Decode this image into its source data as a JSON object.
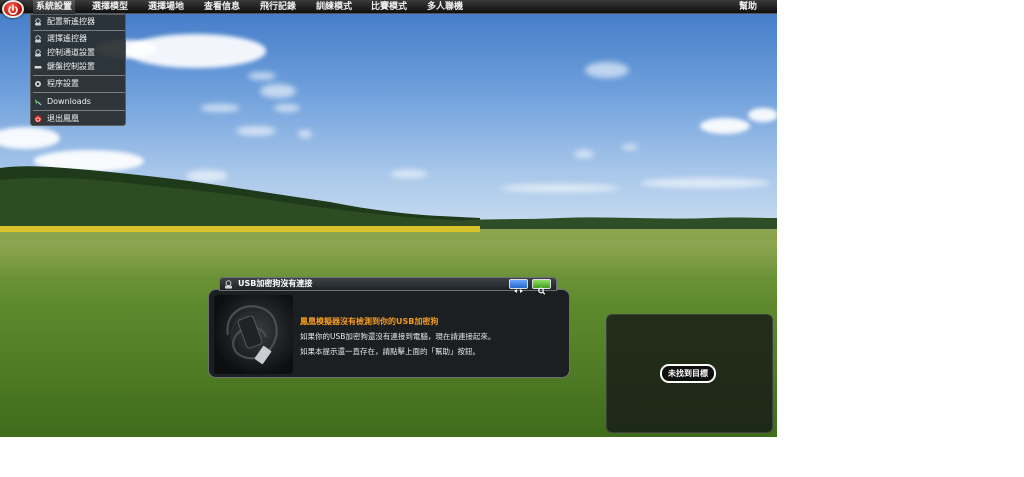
{
  "menu": {
    "items": [
      "系統設置",
      "選擇模型",
      "選擇場地",
      "查看信息",
      "飛行記錄",
      "訓練模式",
      "比賽模式",
      "多人聯機"
    ],
    "help": "幫助",
    "active_index": 0
  },
  "dropdown": {
    "items": [
      {
        "label": "配置新遙控器",
        "icon": "controller-icon"
      },
      {
        "label": "選擇遙控器",
        "icon": "controller-icon"
      },
      {
        "label": "控制通道設置",
        "icon": "controller-icon"
      },
      {
        "label": "鍵盤控制設置",
        "icon": "keyboard-icon"
      },
      {
        "label": "程序設置",
        "icon": "gear-icon"
      },
      {
        "label": "Downloads",
        "icon": "download-icon"
      },
      {
        "label": "退出鳳凰",
        "icon": "power-icon"
      }
    ]
  },
  "dialog": {
    "title": "USB加密狗沒有連接",
    "message_title": "鳳凰模擬器沒有檢測到你的USB加密狗",
    "message_lines": [
      "如果你的USB加密狗還沒有連接到電腦，現在請連接起來。",
      "如果本提示還一直存在，請點擊上面的「幫助」按鈕。"
    ]
  },
  "target_panel": {
    "label": "未找到目標"
  },
  "colors": {
    "accent_orange": "#f39a1e",
    "menubar": "#1a1a1a",
    "power_red": "#c8140a"
  }
}
